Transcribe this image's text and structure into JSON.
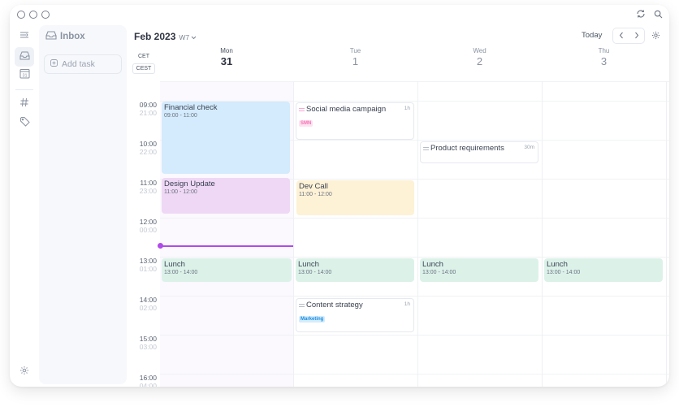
{
  "window": {
    "traffic_lights": [
      "close",
      "minimize",
      "maximize"
    ],
    "top_icons": [
      "sync-icon",
      "search-icon"
    ]
  },
  "rail": {
    "items": [
      {
        "name": "collapse-sidebar",
        "icon": "sidebar-toggle-icon",
        "active": false
      },
      {
        "name": "inbox",
        "icon": "inbox-icon",
        "active": true
      },
      {
        "name": "calendar",
        "icon": "calendar-icon",
        "label": "31",
        "active": false
      },
      {
        "name": "channels",
        "icon": "hash-icon",
        "active": false
      },
      {
        "name": "tags",
        "icon": "tag-icon",
        "active": false
      }
    ],
    "bottom_icon": "settings-icon"
  },
  "inbox": {
    "title": "Inbox",
    "add_task_label": "Add task"
  },
  "header": {
    "month": "Feb 2023",
    "week": "W7",
    "today_label": "Today",
    "timezones": [
      "CET",
      "CEST"
    ]
  },
  "days": [
    {
      "name": "Mon",
      "date": "31",
      "today": true
    },
    {
      "name": "Tue",
      "date": "1",
      "today": false
    },
    {
      "name": "Wed",
      "date": "2",
      "today": false
    },
    {
      "name": "Thu",
      "date": "3",
      "today": false
    }
  ],
  "hours": [
    {
      "primary": "09:00",
      "secondary": "21:00"
    },
    {
      "primary": "10:00",
      "secondary": "22:00"
    },
    {
      "primary": "11:00",
      "secondary": "23:00"
    },
    {
      "primary": "12:00",
      "secondary": "00:00"
    },
    {
      "primary": "13:00",
      "secondary": "01:00"
    },
    {
      "primary": "14:00",
      "secondary": "02:00"
    },
    {
      "primary": "15:00",
      "secondary": "03:00"
    },
    {
      "primary": "16:00",
      "secondary": "04:00"
    }
  ],
  "events": [
    {
      "title": "Financial check",
      "time": "09:00 - 11:00",
      "day": 0,
      "color": "#d3ebfc"
    },
    {
      "title": "Design Update",
      "time": "11:00 - 12:00",
      "day": 0,
      "color": "#efd8f5"
    },
    {
      "title": "Dev Call",
      "time": "11:00 - 12:00",
      "day": 1,
      "color": "#fdf1d6"
    },
    {
      "title": "Lunch",
      "time": "13:00 - 14:00",
      "day": 0,
      "color": "#dcf2e9"
    },
    {
      "title": "Lunch",
      "time": "13:00 - 14:00",
      "day": 1,
      "color": "#dcf2e9"
    },
    {
      "title": "Lunch",
      "time": "13:00 - 14:00",
      "day": 2,
      "color": "#dcf2e9"
    },
    {
      "title": "Lunch",
      "time": "13:00 - 14:00",
      "day": 3,
      "color": "#dcf2e9"
    }
  ],
  "tasks": [
    {
      "title": "Social media campaign",
      "duration": "1h",
      "tag": "SMN",
      "tag_color": "#f472b6",
      "tag_bg": "#fde3f0",
      "day": 1
    },
    {
      "title": "Product requirements",
      "duration": "30m",
      "day": 2
    },
    {
      "title": "Content strategy",
      "duration": "1h",
      "tag": "Marketing",
      "tag_color": "#1d8fe0",
      "tag_bg": "#d5ecfc",
      "day": 1
    }
  ],
  "now_indicator": {
    "time": "12:40",
    "color": "#b04bea"
  }
}
